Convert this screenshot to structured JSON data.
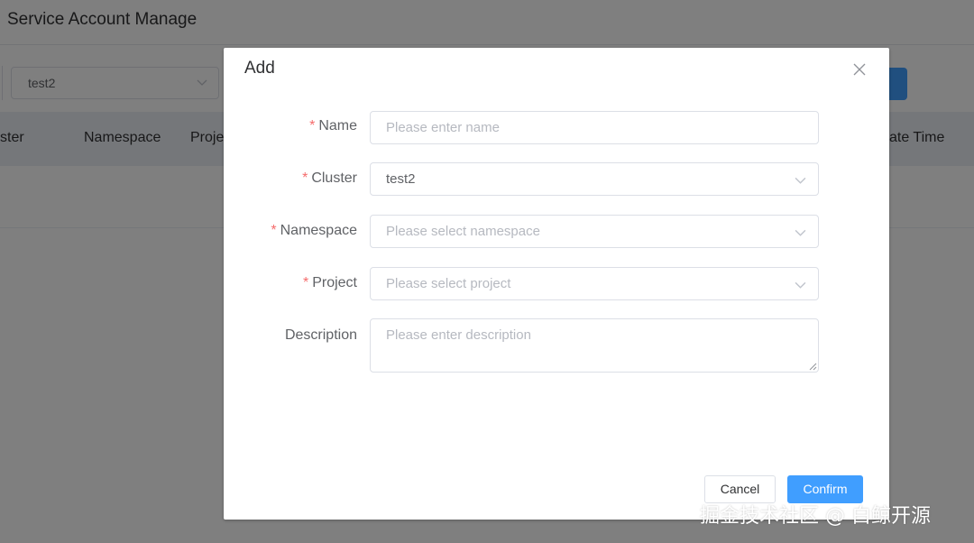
{
  "page": {
    "title": "Service Account Manage"
  },
  "filter": {
    "cluster_value": "test2"
  },
  "table": {
    "headers": [
      "ster",
      "Namespace",
      "Proje",
      "ate Time"
    ]
  },
  "dialog": {
    "title": "Add",
    "required_mark": "*",
    "fields": {
      "name": {
        "label": "Name",
        "placeholder": "Please enter name"
      },
      "cluster": {
        "label": "Cluster",
        "value": "test2"
      },
      "namespace": {
        "label": "Namespace",
        "placeholder": "Please select namespace"
      },
      "project": {
        "label": "Project",
        "placeholder": "Please select project"
      },
      "description": {
        "label": "Description",
        "placeholder": "Please enter description"
      }
    },
    "buttons": {
      "cancel": "Cancel",
      "confirm": "Confirm"
    }
  },
  "watermark": "掘金技术社区 @ 白鲸开源",
  "icons": {
    "close": "close-icon",
    "chevron": "chevron-down-icon",
    "resize": "resize-handle-icon"
  },
  "colors": {
    "primary": "#409eff",
    "required": "#f56c6c",
    "overlay": "rgba(0,0,0,0.5)"
  }
}
